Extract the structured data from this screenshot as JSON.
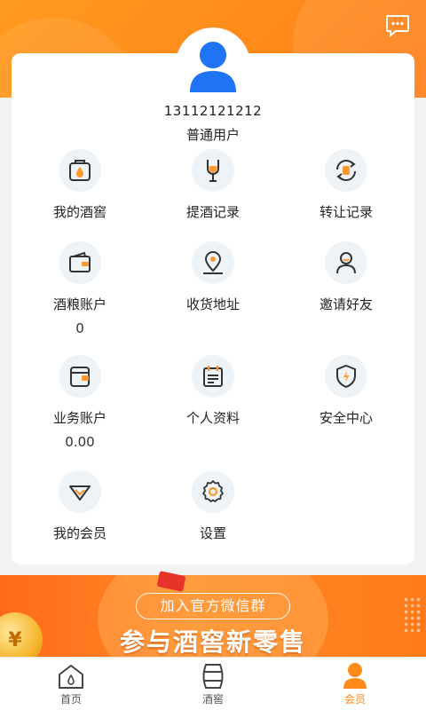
{
  "header": {
    "message_icon": "chat-bubble-icon",
    "accent_color": "#ff8a1a"
  },
  "profile": {
    "avatar_icon": "user-avatar-icon",
    "phone": "13112121212",
    "level": "普通用户"
  },
  "menu": {
    "my_cellar": {
      "label": "我的酒窖",
      "icon": "bottle-basket-icon"
    },
    "withdraw_records": {
      "label": "提酒记录",
      "icon": "wine-glass-icon"
    },
    "transfer_records": {
      "label": "转让记录",
      "icon": "transfer-cycle-icon"
    },
    "grain_account": {
      "label": "酒粮账户",
      "value": "0",
      "icon": "wallet-icon"
    },
    "address": {
      "label": "收货地址",
      "icon": "location-pin-icon"
    },
    "invite": {
      "label": "邀请好友",
      "icon": "person-icon"
    },
    "business_account": {
      "label": "业务账户",
      "value": "0.00",
      "icon": "card-wallet-icon"
    },
    "profile_info": {
      "label": "个人资料",
      "icon": "calendar-document-icon"
    },
    "security": {
      "label": "安全中心",
      "icon": "shield-icon"
    },
    "membership": {
      "label": "我的会员",
      "icon": "diamond-icon"
    },
    "settings": {
      "label": "设置",
      "icon": "gear-icon"
    }
  },
  "banner": {
    "pill_text": "加入官方微信群",
    "title": "参与酒窖新零售",
    "coin_symbol": "¥"
  },
  "tabbar": {
    "home": {
      "label": "首页",
      "icon": "home-icon"
    },
    "cellar": {
      "label": "酒窖",
      "icon": "barrel-icon"
    },
    "member": {
      "label": "会员",
      "icon": "member-icon",
      "active": true
    }
  }
}
